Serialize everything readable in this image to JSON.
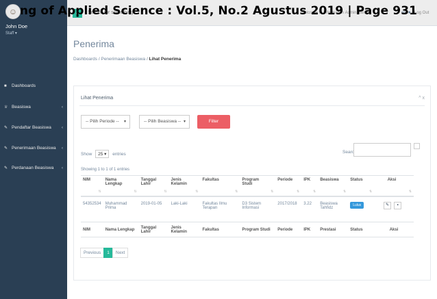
{
  "journal_header": "ng of Applied Science : Vol.5, No.2 Agustus 2019 | Page 931",
  "profile": {
    "name": "John Doe",
    "role": "Staff ▾"
  },
  "sidebar": {
    "items": [
      {
        "label": "Dashboards",
        "icon": "home-icon"
      },
      {
        "label": "Beasiswa",
        "icon": "trophy-icon"
      },
      {
        "label": "Pendaftar Beasiswa",
        "icon": "edit-icon"
      },
      {
        "label": "Penerimaan Beasiswa",
        "icon": "edit-icon"
      },
      {
        "label": "Perdanaan Beasiswa",
        "icon": "edit-icon"
      }
    ]
  },
  "topbar": {
    "search_placeholder": "Search for something...",
    "welcome": "Welcome to Information Admin theme",
    "logout": "Log Out"
  },
  "page": {
    "title": "Penerima",
    "breadcrumb": [
      "Dashboards",
      "Penerimaan Beasiswa",
      "Lihat Penerima"
    ]
  },
  "panel": {
    "title": "Lihat Penerima",
    "tools": "^ x",
    "filter": {
      "periode_selected": "-- Pilih Periode --",
      "beasiswa_selected": "-- Pilih Beasiswa --",
      "button": "Filter"
    },
    "show": {
      "prefix": "Show",
      "value": "25",
      "suffix": "entries"
    },
    "search_label": "Search:",
    "info": "Showing 1 to 1 of 1 entries"
  },
  "table": {
    "headers": [
      "NIM",
      "Nama Lengkap",
      "Tanggal Lahir",
      "Jenis Kelamin",
      "Fakultas",
      "Program Studi",
      "Periode",
      "IPK",
      "Beasiswa",
      "Status",
      "Aksi"
    ],
    "footer_headers": [
      "NIM",
      "Nama Lengkap",
      "Tanggal Lahir",
      "Jenis Kelamin",
      "Fakultas",
      "Program Studi",
      "Periode",
      "IPK",
      "Prestasi",
      "Status",
      "Aksi"
    ],
    "rows": [
      {
        "nim": "54352534",
        "nama": "Muhammad Prima",
        "tanggal_lahir": "2019-01-05",
        "jenis_kelamin": "Laki-Laki",
        "fakultas": "Fakultas Ilmu Terapan",
        "prodi": "D3 Sistem Informasi",
        "periode": "2017/2018",
        "ipk": "3.22",
        "beasiswa": "Beasiswa Tahfidz",
        "status": "Lulus"
      }
    ]
  },
  "pagination": {
    "previous": "Previous",
    "current": "1",
    "next": "Next"
  },
  "colors": {
    "sidebar": "#2a3f54",
    "accent": "#26b99a",
    "filter_button": "#ec5e65",
    "status_badge": "#3498db"
  }
}
